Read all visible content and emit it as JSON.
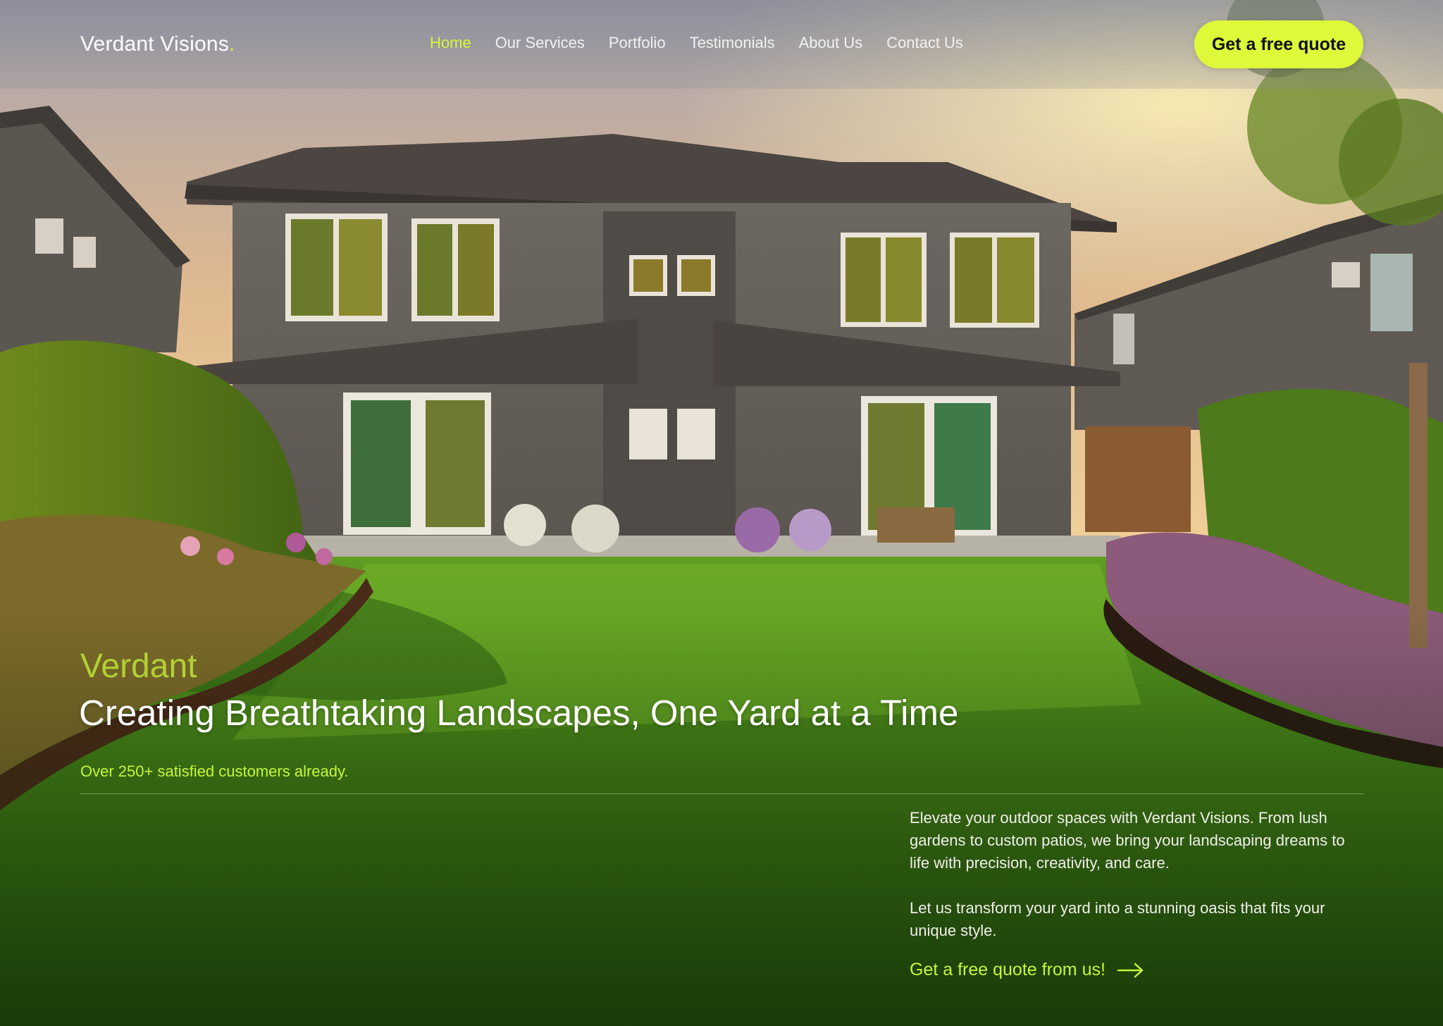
{
  "brand": {
    "name": "Verdant Visions",
    "dot": ".",
    "accent_color": "#d8f53a"
  },
  "nav": {
    "items": [
      {
        "label": "Home",
        "active": true
      },
      {
        "label": "Our Services",
        "active": false
      },
      {
        "label": "Portfolio",
        "active": false
      },
      {
        "label": "Testimonials",
        "active": false
      },
      {
        "label": "About Us",
        "active": false
      },
      {
        "label": "Contact Us",
        "active": false
      }
    ],
    "cta_label": "Get a free quote"
  },
  "hero": {
    "eyebrow": "Verdant",
    "headline": "Creating Breathtaking Landscapes, One Yard at a Time",
    "subline": "Over 250+ satisfied customers already.",
    "paragraph_1": "Elevate your outdoor spaces with Verdant Visions. From lush gardens to custom patios, we bring your landscaping dreams to life with precision, creativity, and care.",
    "paragraph_2": "Let us transform your yard into a stunning oasis that fits your unique style.",
    "link_label": "Get a free quote from us!",
    "link_icon": "arrow-right-icon"
  },
  "background": {
    "subject": "house-backyard-photo-icon"
  }
}
